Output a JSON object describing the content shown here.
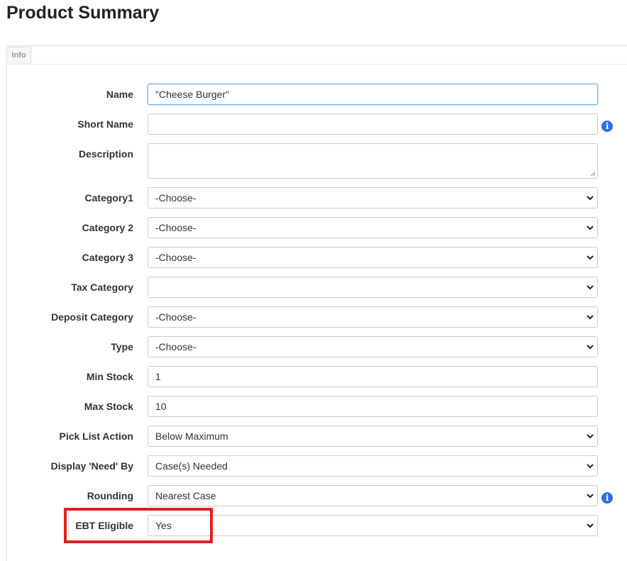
{
  "page": {
    "title": "Product Summary"
  },
  "tabs": {
    "info": "Info"
  },
  "form": {
    "name": {
      "label": "Name",
      "value": "\"Cheese Burger\""
    },
    "short_name": {
      "label": "Short Name",
      "value": "",
      "info_icon": "info-circle-icon"
    },
    "description": {
      "label": "Description",
      "value": ""
    },
    "category1": {
      "label": "Category1",
      "value": "-Choose-"
    },
    "category2": {
      "label": "Category 2",
      "value": "-Choose-"
    },
    "category3": {
      "label": "Category 3",
      "value": "-Choose-"
    },
    "tax_category": {
      "label": "Tax Category",
      "value": ""
    },
    "deposit_category": {
      "label": "Deposit Category",
      "value": "-Choose-"
    },
    "type": {
      "label": "Type",
      "value": "-Choose-"
    },
    "min_stock": {
      "label": "Min Stock",
      "value": "1"
    },
    "max_stock": {
      "label": "Max Stock",
      "value": "10"
    },
    "pick_list_action": {
      "label": "Pick List Action",
      "value": "Below Maximum"
    },
    "display_need_by": {
      "label": "Display 'Need' By",
      "value": "Case(s) Needed"
    },
    "rounding": {
      "label": "Rounding",
      "value": "Nearest Case",
      "info_icon": "info-circle-icon"
    },
    "ebt_eligible": {
      "label": "EBT Eligible",
      "value": "Yes"
    }
  },
  "colors": {
    "focus_border": "#66afe9",
    "info_icon": "#2f6ee6",
    "highlight": "#e02020"
  }
}
